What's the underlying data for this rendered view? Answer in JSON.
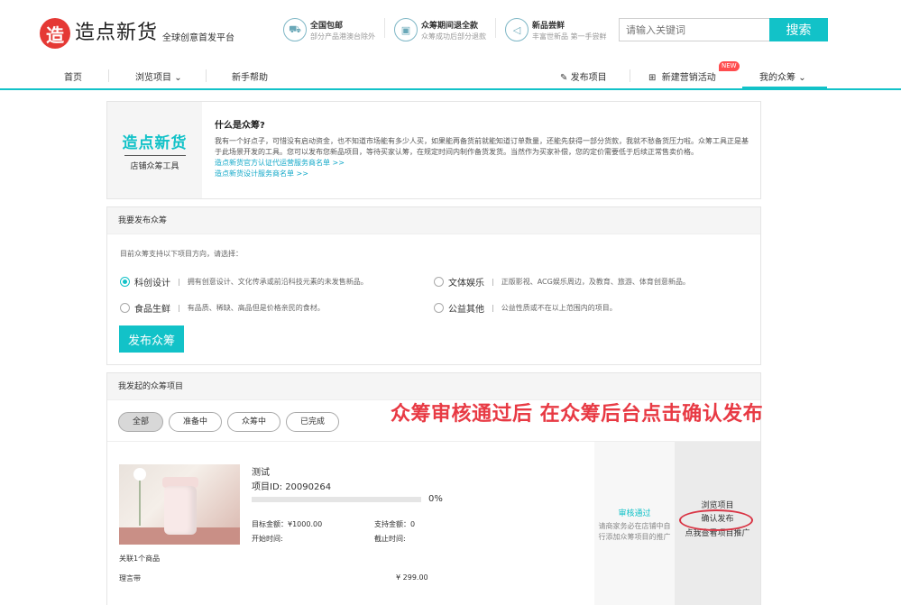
{
  "header": {
    "logo_mark": "造",
    "logo_text": "造点新货",
    "logo_sub": "全球创意首发平台",
    "features": [
      {
        "title": "全国包邮",
        "desc": "部分产品港澳台除外",
        "icon": "truck-icon"
      },
      {
        "title": "众筹期间退全款",
        "desc": "众筹成功后部分退款",
        "icon": "refund-icon"
      },
      {
        "title": "新品尝鲜",
        "desc": "丰富世新品 第一手尝鲜",
        "icon": "speaker-icon"
      }
    ],
    "search": {
      "placeholder": "请输入关键词",
      "button": "搜索"
    }
  },
  "nav": {
    "home": "首页",
    "browse": "浏览项目",
    "help": "新手帮助",
    "publish": "发布项目",
    "campaign": "新建营销活动",
    "badge": "NEW",
    "my": "我的众筹"
  },
  "intro": {
    "brand": "造点新货",
    "tag": "店铺众筹工具",
    "question": "什么是众筹?",
    "body": "我有一个好点子，可惜没有启动资金，也不知道市场能有多少人买，如果能再备货前就能知道订单数量，还能先获得一部分货款，我就不愁备货压力啦。众筹工具正是基于此场景开发的工具。您可以发布您新品项目，等待买家认筹，在规定时间内制作备货发货。当然作为买家补偿，您的定价需要低于后续正常售卖价格。",
    "link1": "造点新货官方认证代运营服务商名单 >>",
    "link2": "造点新货设计服务商名单 >>"
  },
  "publish": {
    "head": "我要发布众筹",
    "hint": "目前众筹支持以下项目方向，请选择：",
    "options": [
      {
        "name": "科创设计",
        "desc": "拥有创意设计、文化传承或前沿科技元素的未发售新品。"
      },
      {
        "name": "文体娱乐",
        "desc": "正版影视、ACG娱乐周边，及教育、旅游、体育创意新品。"
      },
      {
        "name": "食品生鲜",
        "desc": "有品质、稀缺、高品但是价格亲民的食材。"
      },
      {
        "name": "公益其他",
        "desc": "公益性质或不在以上范围内的项目。"
      }
    ],
    "button": "发布众筹"
  },
  "mine": {
    "head": "我发起的众筹项目",
    "tabs": [
      "全部",
      "准备中",
      "众筹中",
      "已完成"
    ],
    "project": {
      "title": "测试",
      "id": "项目ID: 20090264",
      "progress": 0,
      "progress_text": "0%",
      "target": "目标金额：¥1000.00",
      "support": "支持金额：0",
      "start": "开始时间:",
      "end": "截止时间:",
      "related": "关联1个商品",
      "goods_name": "理言带",
      "goods_price": "¥ 299.00",
      "status": "审核通过",
      "status_desc": "请商家务必在店铺中自行添加众筹项目的推广",
      "actions": [
        "浏览项目",
        "确认发布",
        "点我查看项目推广"
      ]
    }
  },
  "annotation": "众筹审核通过后 在众筹后台点击确认发布"
}
